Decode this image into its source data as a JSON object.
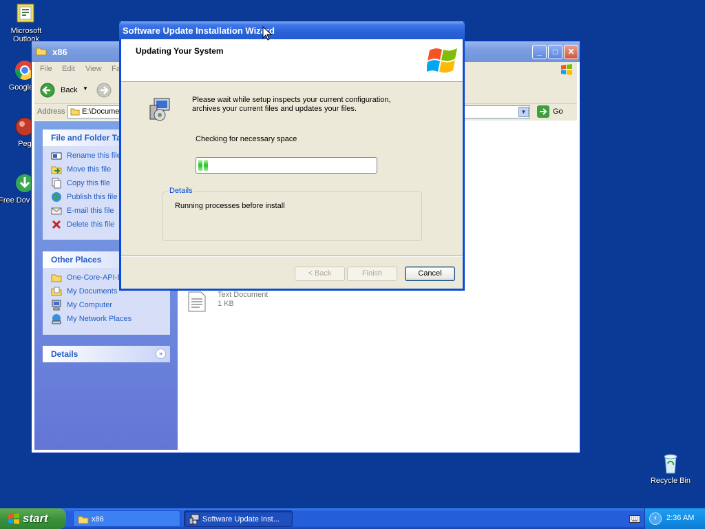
{
  "desktop": {
    "icons": [
      {
        "label": "Microsoft Outlook"
      },
      {
        "label": "Google C"
      },
      {
        "label": "Peg"
      },
      {
        "label": "Free Dov Mana"
      },
      {
        "label": "Recycle Bin"
      }
    ]
  },
  "explorer": {
    "title": "x86",
    "menu": [
      "File",
      "Edit",
      "View",
      "Fa"
    ],
    "back_label": "Back",
    "address_label": "Address",
    "address_value": "E:\\Docume",
    "go_label": "Go",
    "file_tasks": {
      "title": "File and Folder Ta",
      "items": [
        "Rename this file",
        "Move this file",
        "Copy this file",
        "Publish this file t",
        "E-mail this file",
        "Delete this file"
      ]
    },
    "other_places": {
      "title": "Other Places",
      "items": [
        "One-Core-API-B",
        "My Documents",
        "My Computer",
        "My Network Places"
      ]
    },
    "details_title": "Details",
    "file": {
      "type": "Text Document",
      "size": "1 KB"
    }
  },
  "dialog": {
    "title": "Software Update Installation Wizard",
    "heading": "Updating Your System",
    "description": "Please wait while setup inspects your current configuration, archives your current files and updates your files.",
    "status": "Checking for necessary space",
    "progress": 0.05,
    "details_legend": "Details",
    "details_text": "Running processes before install",
    "back_label": "< Back",
    "finish_label": "Finish",
    "cancel_label": "Cancel"
  },
  "taskbar": {
    "start_label": "start",
    "tasks": [
      "x86",
      "Software Update Inst..."
    ],
    "clock": "2:36 AM"
  }
}
